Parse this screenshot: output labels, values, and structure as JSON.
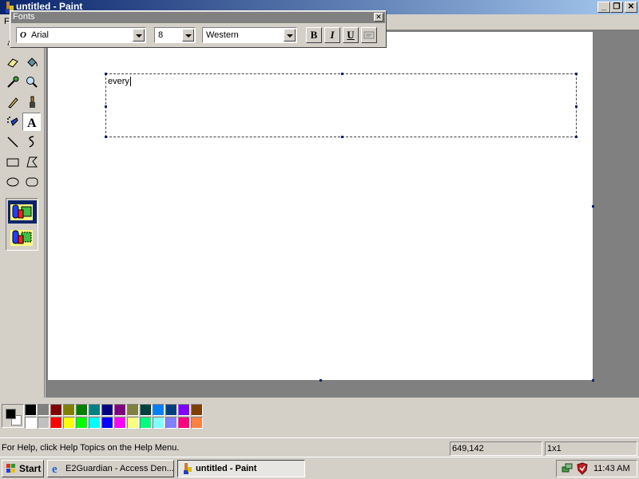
{
  "window": {
    "title": "untitled - Paint"
  },
  "menu": {
    "first_item": "F"
  },
  "fonts_toolbar": {
    "title": "Fonts",
    "font_name": "Arial",
    "font_size": "8",
    "script": "Western",
    "bold_label": "B",
    "italic_label": "I",
    "underline_label": "U"
  },
  "canvas": {
    "typed_text": "every"
  },
  "colors": {
    "foreground": "#000000",
    "background": "#ffffff",
    "palette_top": [
      "#000000",
      "#808080",
      "#800000",
      "#808000",
      "#008000",
      "#008080",
      "#000080",
      "#800080",
      "#808040",
      "#004040",
      "#0080ff",
      "#004080",
      "#8000ff",
      "#804000"
    ],
    "palette_bottom": [
      "#ffffff",
      "#c0c0c0",
      "#ff0000",
      "#ffff00",
      "#00ff00",
      "#00ffff",
      "#0000ff",
      "#ff00ff",
      "#ffff80",
      "#00ff80",
      "#80ffff",
      "#8080ff",
      "#ff0080",
      "#ff8040"
    ]
  },
  "status": {
    "help_text": "For Help, click Help Topics on the Help Menu.",
    "cursor_position": "649,142",
    "selection_size": "1x1"
  },
  "taskbar": {
    "start_label": "Start",
    "tasks": [
      {
        "label": "E2Guardian - Access Den...",
        "active": false
      },
      {
        "label": "untitled - Paint",
        "active": true
      }
    ],
    "clock": "11:43 AM"
  },
  "icons": [
    "paint-app-icon",
    "minimize-icon",
    "restore-icon",
    "close-icon",
    "free-select-icon",
    "select-icon",
    "eraser-icon",
    "fill-icon",
    "color-picker-icon",
    "magnifier-icon",
    "pencil-icon",
    "brush-icon",
    "airbrush-icon",
    "text-icon",
    "line-icon",
    "curve-icon",
    "rectangle-icon",
    "polygon-icon",
    "ellipse-icon",
    "rounded-rect-icon",
    "opaque-bg-icon",
    "transparent-bg-icon",
    "ie-icon",
    "windows-logo-icon",
    "network-icon",
    "shield-icon"
  ]
}
